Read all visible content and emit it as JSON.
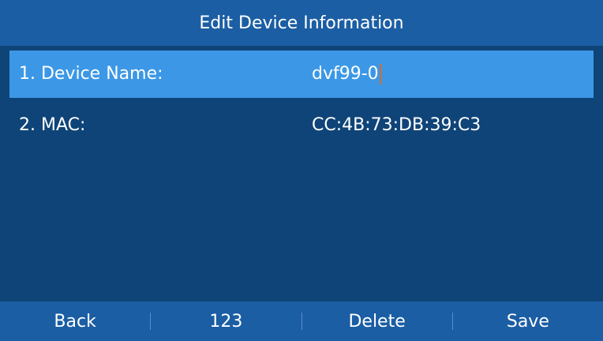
{
  "title": "Edit Device Information",
  "rows": [
    {
      "label": "1. Device Name:",
      "value": "dvf99-0",
      "selected": true
    },
    {
      "label": "2. MAC:",
      "value": "CC:4B:73:DB:39:C3",
      "selected": false
    }
  ],
  "softkeys": {
    "back": "Back",
    "input_mode": "123",
    "delete": "Delete",
    "save": "Save"
  },
  "colors": {
    "title_bar": "#1b5ea4",
    "background": "#0f4478",
    "selected_row": "#3c98e6",
    "caret": "#d86a22"
  }
}
